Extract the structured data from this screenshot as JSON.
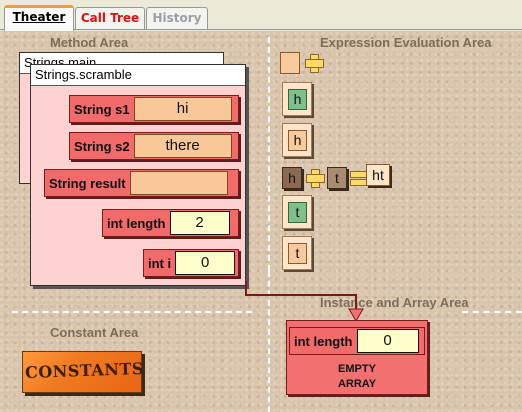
{
  "tabs": [
    {
      "label": "Theater",
      "active": true
    },
    {
      "label": "Call Tree",
      "active": false
    },
    {
      "label": "History",
      "active": false
    }
  ],
  "areas": {
    "method": "Method Area",
    "expression": "Expression Evaluation Area",
    "instance": "Instance and Array Area",
    "constant": "Constant Area"
  },
  "frames": {
    "back_title": "Strings.main",
    "front_title": "Strings.scramble"
  },
  "variables": {
    "s1": {
      "label": "String s1",
      "value": "hi"
    },
    "s2": {
      "label": "String s2",
      "value": "there"
    },
    "result": {
      "label": "String result",
      "value": ""
    },
    "length": {
      "label": "int length",
      "value": "2"
    },
    "i": {
      "label": "int i",
      "value": "0"
    }
  },
  "expression": {
    "tile1": "h",
    "tile2": "h",
    "concat_left": "h",
    "concat_right": "t",
    "concat_result": "ht",
    "tile4": "t",
    "tile5": "t"
  },
  "instance": {
    "label": "int length",
    "value": "0",
    "line1": "EMPTY",
    "line2": "ARRAY"
  },
  "constants_label": "CONSTANTS",
  "colors": {
    "frame_body": "#ffd2d2",
    "variable_box": "#f26a6a",
    "string_value": "#f9c89a",
    "int_value": "#ffffcc",
    "tile_green": "#7fbf8c",
    "constants_orange": "#f07a20"
  }
}
